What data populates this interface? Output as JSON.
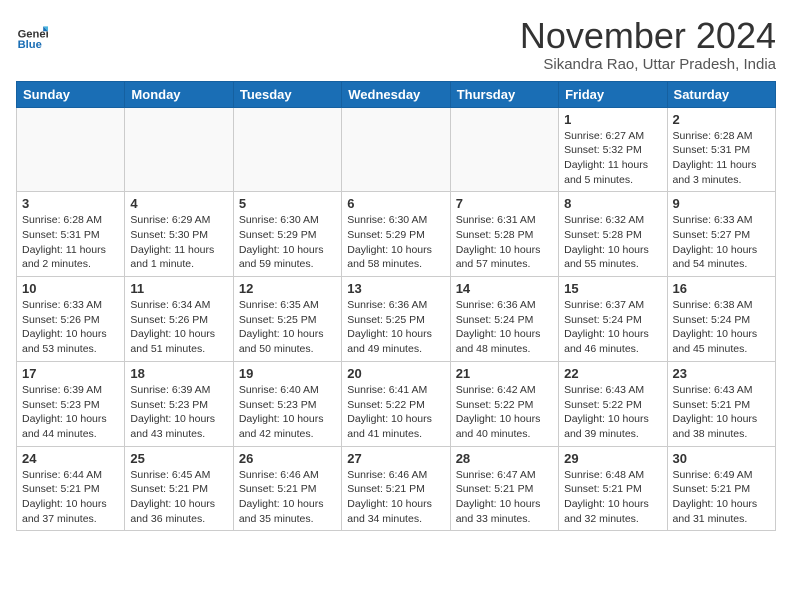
{
  "header": {
    "logo_line1": "General",
    "logo_line2": "Blue",
    "month": "November 2024",
    "location": "Sikandra Rao, Uttar Pradesh, India"
  },
  "weekdays": [
    "Sunday",
    "Monday",
    "Tuesday",
    "Wednesday",
    "Thursday",
    "Friday",
    "Saturday"
  ],
  "weeks": [
    [
      {
        "day": "",
        "info": ""
      },
      {
        "day": "",
        "info": ""
      },
      {
        "day": "",
        "info": ""
      },
      {
        "day": "",
        "info": ""
      },
      {
        "day": "",
        "info": ""
      },
      {
        "day": "1",
        "info": "Sunrise: 6:27 AM\nSunset: 5:32 PM\nDaylight: 11 hours and 5 minutes."
      },
      {
        "day": "2",
        "info": "Sunrise: 6:28 AM\nSunset: 5:31 PM\nDaylight: 11 hours and 3 minutes."
      }
    ],
    [
      {
        "day": "3",
        "info": "Sunrise: 6:28 AM\nSunset: 5:31 PM\nDaylight: 11 hours and 2 minutes."
      },
      {
        "day": "4",
        "info": "Sunrise: 6:29 AM\nSunset: 5:30 PM\nDaylight: 11 hours and 1 minute."
      },
      {
        "day": "5",
        "info": "Sunrise: 6:30 AM\nSunset: 5:29 PM\nDaylight: 10 hours and 59 minutes."
      },
      {
        "day": "6",
        "info": "Sunrise: 6:30 AM\nSunset: 5:29 PM\nDaylight: 10 hours and 58 minutes."
      },
      {
        "day": "7",
        "info": "Sunrise: 6:31 AM\nSunset: 5:28 PM\nDaylight: 10 hours and 57 minutes."
      },
      {
        "day": "8",
        "info": "Sunrise: 6:32 AM\nSunset: 5:28 PM\nDaylight: 10 hours and 55 minutes."
      },
      {
        "day": "9",
        "info": "Sunrise: 6:33 AM\nSunset: 5:27 PM\nDaylight: 10 hours and 54 minutes."
      }
    ],
    [
      {
        "day": "10",
        "info": "Sunrise: 6:33 AM\nSunset: 5:26 PM\nDaylight: 10 hours and 53 minutes."
      },
      {
        "day": "11",
        "info": "Sunrise: 6:34 AM\nSunset: 5:26 PM\nDaylight: 10 hours and 51 minutes."
      },
      {
        "day": "12",
        "info": "Sunrise: 6:35 AM\nSunset: 5:25 PM\nDaylight: 10 hours and 50 minutes."
      },
      {
        "day": "13",
        "info": "Sunrise: 6:36 AM\nSunset: 5:25 PM\nDaylight: 10 hours and 49 minutes."
      },
      {
        "day": "14",
        "info": "Sunrise: 6:36 AM\nSunset: 5:24 PM\nDaylight: 10 hours and 48 minutes."
      },
      {
        "day": "15",
        "info": "Sunrise: 6:37 AM\nSunset: 5:24 PM\nDaylight: 10 hours and 46 minutes."
      },
      {
        "day": "16",
        "info": "Sunrise: 6:38 AM\nSunset: 5:24 PM\nDaylight: 10 hours and 45 minutes."
      }
    ],
    [
      {
        "day": "17",
        "info": "Sunrise: 6:39 AM\nSunset: 5:23 PM\nDaylight: 10 hours and 44 minutes."
      },
      {
        "day": "18",
        "info": "Sunrise: 6:39 AM\nSunset: 5:23 PM\nDaylight: 10 hours and 43 minutes."
      },
      {
        "day": "19",
        "info": "Sunrise: 6:40 AM\nSunset: 5:23 PM\nDaylight: 10 hours and 42 minutes."
      },
      {
        "day": "20",
        "info": "Sunrise: 6:41 AM\nSunset: 5:22 PM\nDaylight: 10 hours and 41 minutes."
      },
      {
        "day": "21",
        "info": "Sunrise: 6:42 AM\nSunset: 5:22 PM\nDaylight: 10 hours and 40 minutes."
      },
      {
        "day": "22",
        "info": "Sunrise: 6:43 AM\nSunset: 5:22 PM\nDaylight: 10 hours and 39 minutes."
      },
      {
        "day": "23",
        "info": "Sunrise: 6:43 AM\nSunset: 5:21 PM\nDaylight: 10 hours and 38 minutes."
      }
    ],
    [
      {
        "day": "24",
        "info": "Sunrise: 6:44 AM\nSunset: 5:21 PM\nDaylight: 10 hours and 37 minutes."
      },
      {
        "day": "25",
        "info": "Sunrise: 6:45 AM\nSunset: 5:21 PM\nDaylight: 10 hours and 36 minutes."
      },
      {
        "day": "26",
        "info": "Sunrise: 6:46 AM\nSunset: 5:21 PM\nDaylight: 10 hours and 35 minutes."
      },
      {
        "day": "27",
        "info": "Sunrise: 6:46 AM\nSunset: 5:21 PM\nDaylight: 10 hours and 34 minutes."
      },
      {
        "day": "28",
        "info": "Sunrise: 6:47 AM\nSunset: 5:21 PM\nDaylight: 10 hours and 33 minutes."
      },
      {
        "day": "29",
        "info": "Sunrise: 6:48 AM\nSunset: 5:21 PM\nDaylight: 10 hours and 32 minutes."
      },
      {
        "day": "30",
        "info": "Sunrise: 6:49 AM\nSunset: 5:21 PM\nDaylight: 10 hours and 31 minutes."
      }
    ]
  ]
}
